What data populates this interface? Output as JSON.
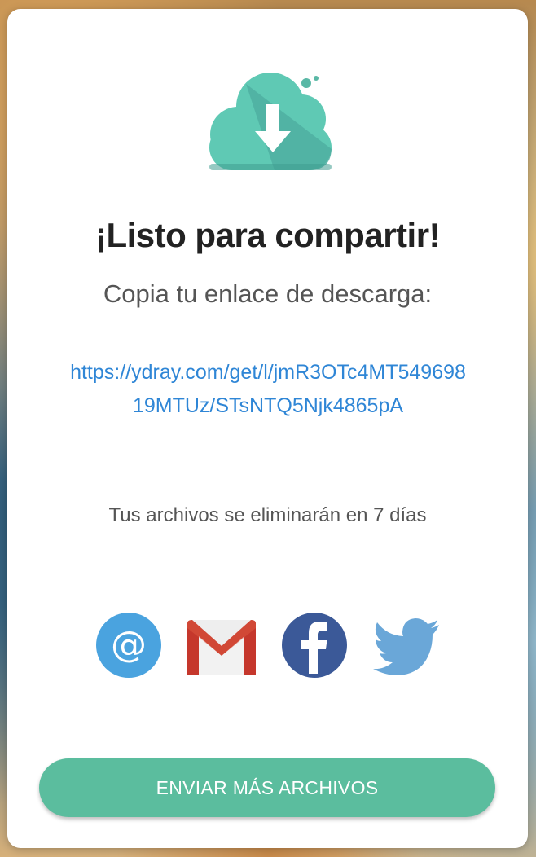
{
  "dialog": {
    "title": "¡Listo para compartir!",
    "subtitle": "Copia tu enlace de descarga:",
    "download_link": "https://ydray.com/get/l/jmR3OTc4MT54969819MTUz/STsNTQ5Njk4865pA",
    "expiry_notice": "Tus archivos se eliminarán en 7 días",
    "send_more_label": "ENVIAR MÁS ARCHIVOS"
  },
  "icons": {
    "hero": "cloud-download-icon",
    "share": [
      "email-icon",
      "gmail-icon",
      "facebook-icon",
      "twitter-icon"
    ]
  },
  "colors": {
    "accent": "#5bbd9e",
    "link": "#2f86d6",
    "email": "#4aa3df",
    "gmail_red": "#d14836",
    "facebook": "#3b5998",
    "twitter": "#6aa7d8"
  }
}
